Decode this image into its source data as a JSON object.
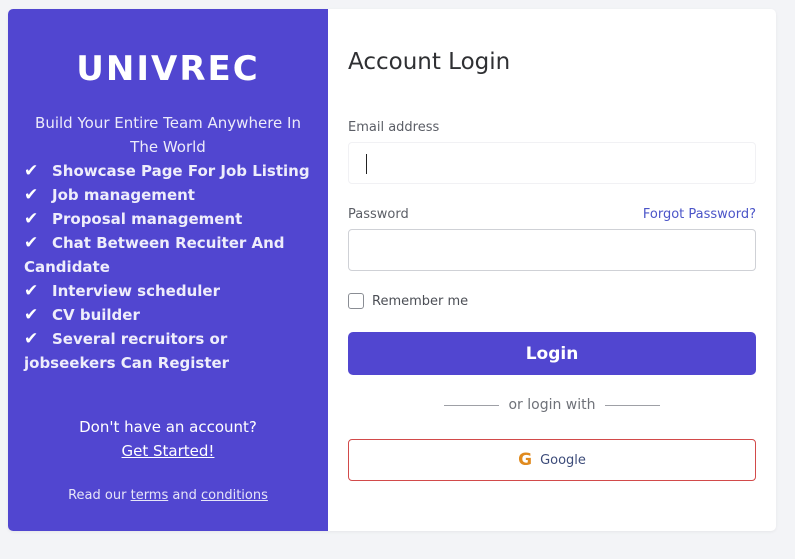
{
  "brand": {
    "name": "UNIVREC",
    "tagline": "Build Your Entire Team Anywhere In The World",
    "accent": "#5146d0"
  },
  "features": [
    "Showcase Page For Job Listing",
    "Job management",
    "Proposal management",
    "Chat Between Recuiter And Candidate",
    "Interview scheduler",
    "CV builder",
    "Several recruitors or jobseekers Can Register"
  ],
  "signup": {
    "question": "Don't have an account?",
    "link": "Get Started!"
  },
  "terms": {
    "prefix": "Read our",
    "terms_link": "terms",
    "and": "and",
    "conditions_link": "conditions"
  },
  "form": {
    "title": "Account Login",
    "email_label": "Email address",
    "email_value": "",
    "password_label": "Password",
    "password_value": "",
    "forgot": "Forgot Password?",
    "remember": "Remember me",
    "login": "Login",
    "or_login_with": "or login with",
    "google": "Google",
    "google_icon": "G"
  }
}
